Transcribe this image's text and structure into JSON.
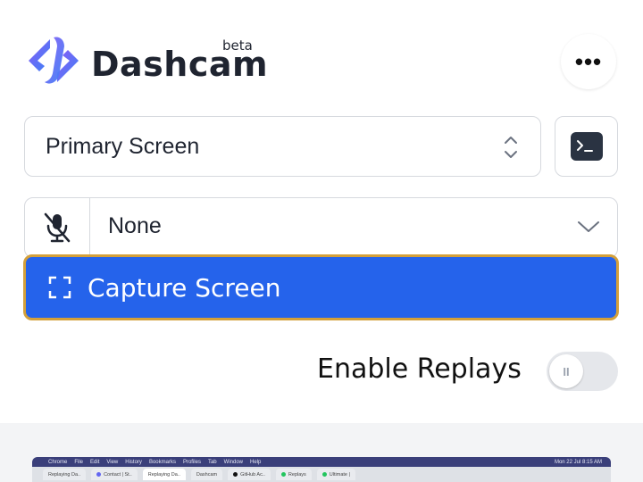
{
  "header": {
    "brand": "Dashcam",
    "badge": "beta",
    "more_label": "•••",
    "logo_colors": {
      "start": "#8b5cf6",
      "end": "#3b82f6"
    }
  },
  "screen_select": {
    "value": "Primary Screen",
    "icon": "chevron-up-down-icon"
  },
  "terminal_button": {
    "icon": "terminal-icon"
  },
  "mic_select": {
    "value": "None",
    "icon": "microphone-muted-icon",
    "chevron_icon": "chevron-down-icon"
  },
  "capture_button": {
    "label": "Capture Screen",
    "icon": "fullscreen-corners-icon",
    "color": "#2563eb",
    "border_color": "#d4a03a"
  },
  "replays": {
    "label": "Enable Replays",
    "enabled": false,
    "knob_symbol": "II"
  },
  "preview": {
    "menubar": [
      "Chrome",
      "File",
      "Edit",
      "View",
      "History",
      "Bookmarks",
      "Profiles",
      "Tab",
      "Window",
      "Help"
    ],
    "menubar_right": "Mon 22 Jul 8:15 AM",
    "tabs": [
      {
        "label": "Replaying Da..",
        "active": false
      },
      {
        "label": "Contact | St..",
        "active": false
      },
      {
        "label": "Replaying Da..",
        "active": true
      },
      {
        "label": "Dashcam",
        "active": false
      },
      {
        "label": "GitHub Ac..",
        "active": false
      },
      {
        "label": "Replays",
        "active": false
      },
      {
        "label": "Ultimate |",
        "active": false
      }
    ]
  }
}
